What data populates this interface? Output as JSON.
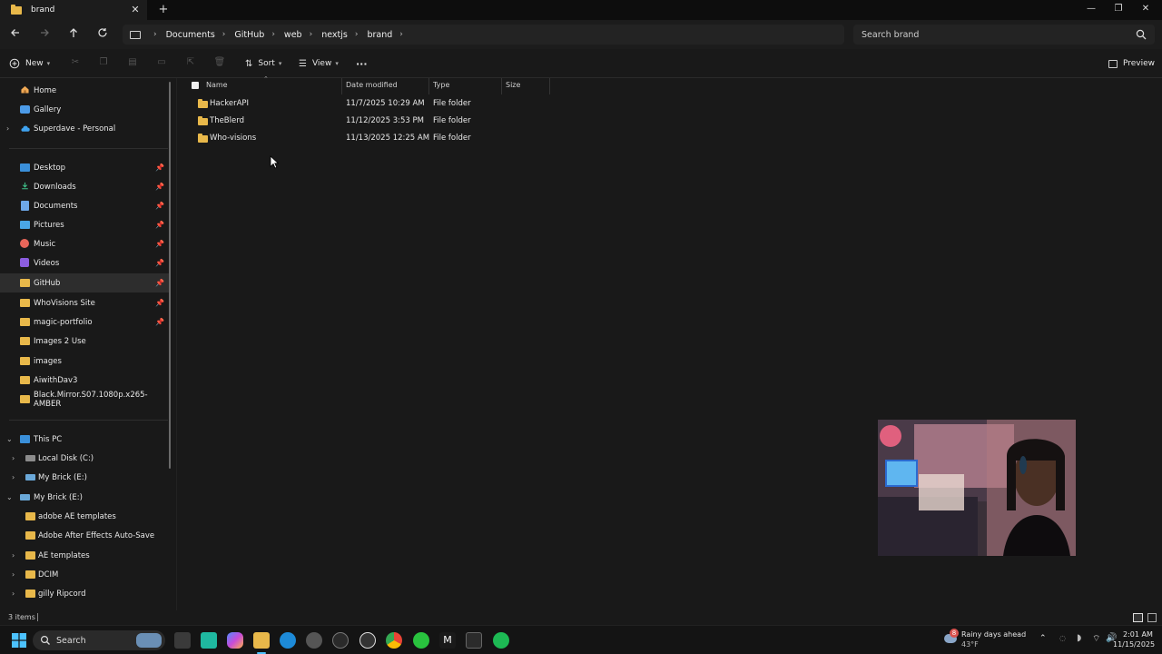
{
  "window": {
    "tab_title": "brand",
    "close_tab": "✕",
    "new_tab": "+",
    "minimize": "—",
    "maximize": "❐",
    "close": "✕"
  },
  "address": {
    "breadcrumbs": [
      "Documents",
      "GitHub",
      "web",
      "nextjs",
      "brand"
    ],
    "search_placeholder": "Search brand"
  },
  "toolbar": {
    "new_label": "New",
    "sort_label": "Sort",
    "view_label": "View",
    "more_label": "···",
    "preview_label": "Preview"
  },
  "sidebar": {
    "top": [
      {
        "label": "Home",
        "icon": "home-icon"
      },
      {
        "label": "Gallery",
        "icon": "gallery-icon"
      },
      {
        "label": "Superdave - Personal",
        "icon": "cloud-icon"
      }
    ],
    "quick_access": [
      {
        "label": "Desktop",
        "icon": "desktop-icon",
        "pinned": true
      },
      {
        "label": "Downloads",
        "icon": "download-icon",
        "pinned": true
      },
      {
        "label": "Documents",
        "icon": "document-icon",
        "pinned": true
      },
      {
        "label": "Pictures",
        "icon": "pictures-icon",
        "pinned": true
      },
      {
        "label": "Music",
        "icon": "music-icon",
        "pinned": true
      },
      {
        "label": "Videos",
        "icon": "videos-icon",
        "pinned": true
      },
      {
        "label": "GitHub",
        "icon": "folder-icon",
        "pinned": true,
        "selected": true
      },
      {
        "label": "WhoVisions Site",
        "icon": "folder-icon",
        "pinned": true
      },
      {
        "label": "magic-portfolio",
        "icon": "folder-icon",
        "pinned": true
      },
      {
        "label": "Images 2 Use",
        "icon": "folder-icon"
      },
      {
        "label": "images",
        "icon": "folder-icon"
      },
      {
        "label": "AiwithDav3",
        "icon": "folder-icon"
      },
      {
        "label": "Black.Mirror.S07.1080p.x265-AMBER",
        "icon": "folder-icon"
      }
    ],
    "this_pc": {
      "label": "This PC"
    },
    "drives": [
      {
        "label": "Local Disk (C:)",
        "icon": "drive-icon"
      },
      {
        "label": "My Brick  (E:)",
        "icon": "drive-icon"
      }
    ],
    "my_brick": {
      "label": "My Brick  (E:)"
    },
    "brick_items": [
      {
        "label": "adobe AE templates",
        "expandable": false
      },
      {
        "label": "Adobe After Effects Auto-Save",
        "expandable": false
      },
      {
        "label": "AE templates",
        "expandable": true
      },
      {
        "label": "DCIM",
        "expandable": true
      },
      {
        "label": "gilly Ripcord",
        "expandable": true
      }
    ]
  },
  "file_list": {
    "columns": [
      "Name",
      "Date modified",
      "Type",
      "Size"
    ],
    "rows": [
      {
        "name": "HackerAPI",
        "date": "11/7/2025 10:29 AM",
        "type": "File folder",
        "size": ""
      },
      {
        "name": "TheBlerd",
        "date": "11/12/2025 3:53 PM",
        "type": "File folder",
        "size": ""
      },
      {
        "name": "Who-visions",
        "date": "11/13/2025 12:25 AM",
        "type": "File folder",
        "size": ""
      }
    ]
  },
  "status": {
    "item_count": "3 items"
  },
  "taskbar": {
    "search_label": "Search",
    "weather_title": "Rainy days ahead",
    "weather_temp": "43°F",
    "weather_badge": "8",
    "time": "2:01 AM",
    "date": "11/15/2025"
  },
  "colors": {
    "folder": "#e8b84a",
    "background": "#191919",
    "selected": "#2d2d2d",
    "accent": "#4cc2ff"
  }
}
